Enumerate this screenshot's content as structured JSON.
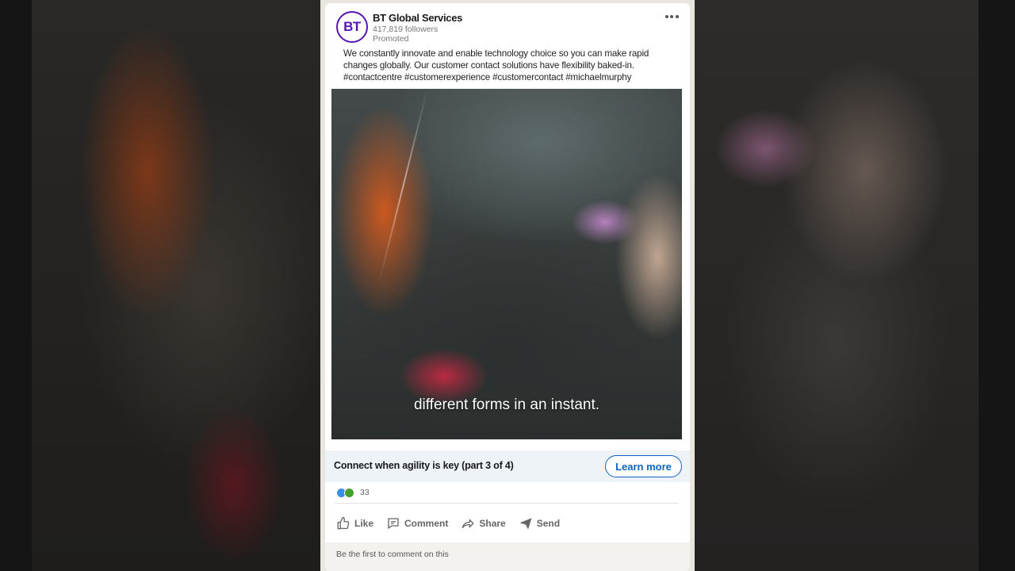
{
  "post": {
    "company_name": "BT Global Services",
    "logo_text": "BT",
    "followers": "417,819 followers",
    "promoted_label": "Promoted",
    "text_lines": [
      "We constantly innovate and enable technology choice so you can make rapid",
      "changes globally. Our customer contact solutions have flexibility baked-in.",
      "#contactcentre #customerexperience #customercontact #michaelmurphy"
    ]
  },
  "video": {
    "caption": "different forms in an instant."
  },
  "cta": {
    "title": "Connect when agility is key (part 3 of 4)",
    "button_label": "Learn more"
  },
  "social": {
    "reaction_count": "33",
    "actions": {
      "like": "Like",
      "comment": "Comment",
      "share": "Share",
      "send": "Send"
    },
    "first_comment_prompt": "Be the first to comment on this"
  },
  "colors": {
    "brand": "#5514b4",
    "accent": "#0a66c2",
    "like_reaction": "#378fe9",
    "celebrate_reaction": "#44a12f"
  }
}
